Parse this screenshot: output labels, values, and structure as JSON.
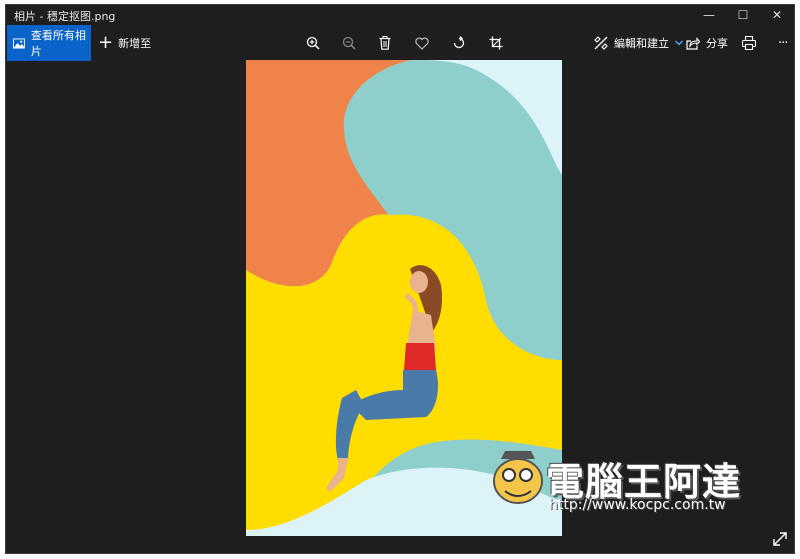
{
  "window": {
    "title": "相片 - 穩定抠图.png",
    "minimize_glyph": "—",
    "maximize_glyph": "☐",
    "close_glyph": "✕"
  },
  "toolbar": {
    "view_all_label": "查看所有相片",
    "add_to_label": "新增至",
    "add_to_glyph": "+",
    "edit_create_label": "編輯和建立",
    "share_label": "分享",
    "more_glyph": "···",
    "icons": [
      "zoom-in-icon",
      "zoom-out-icon",
      "delete-icon",
      "favorite-icon",
      "rotate-icon",
      "crop-icon",
      "edit-icon",
      "share-icon",
      "print-icon",
      "more-icon",
      "expand-icon"
    ]
  },
  "watermark": {
    "text": "電腦王阿達",
    "url": "http://www.kocpc.com.tw"
  },
  "colors": {
    "accent": "#0a63c9",
    "background": "#1e1e1e",
    "orange": "#f0834a",
    "teal": "#8ecfcb",
    "light_blue": "#dcf3f8",
    "yellow": "#ffdd00"
  }
}
